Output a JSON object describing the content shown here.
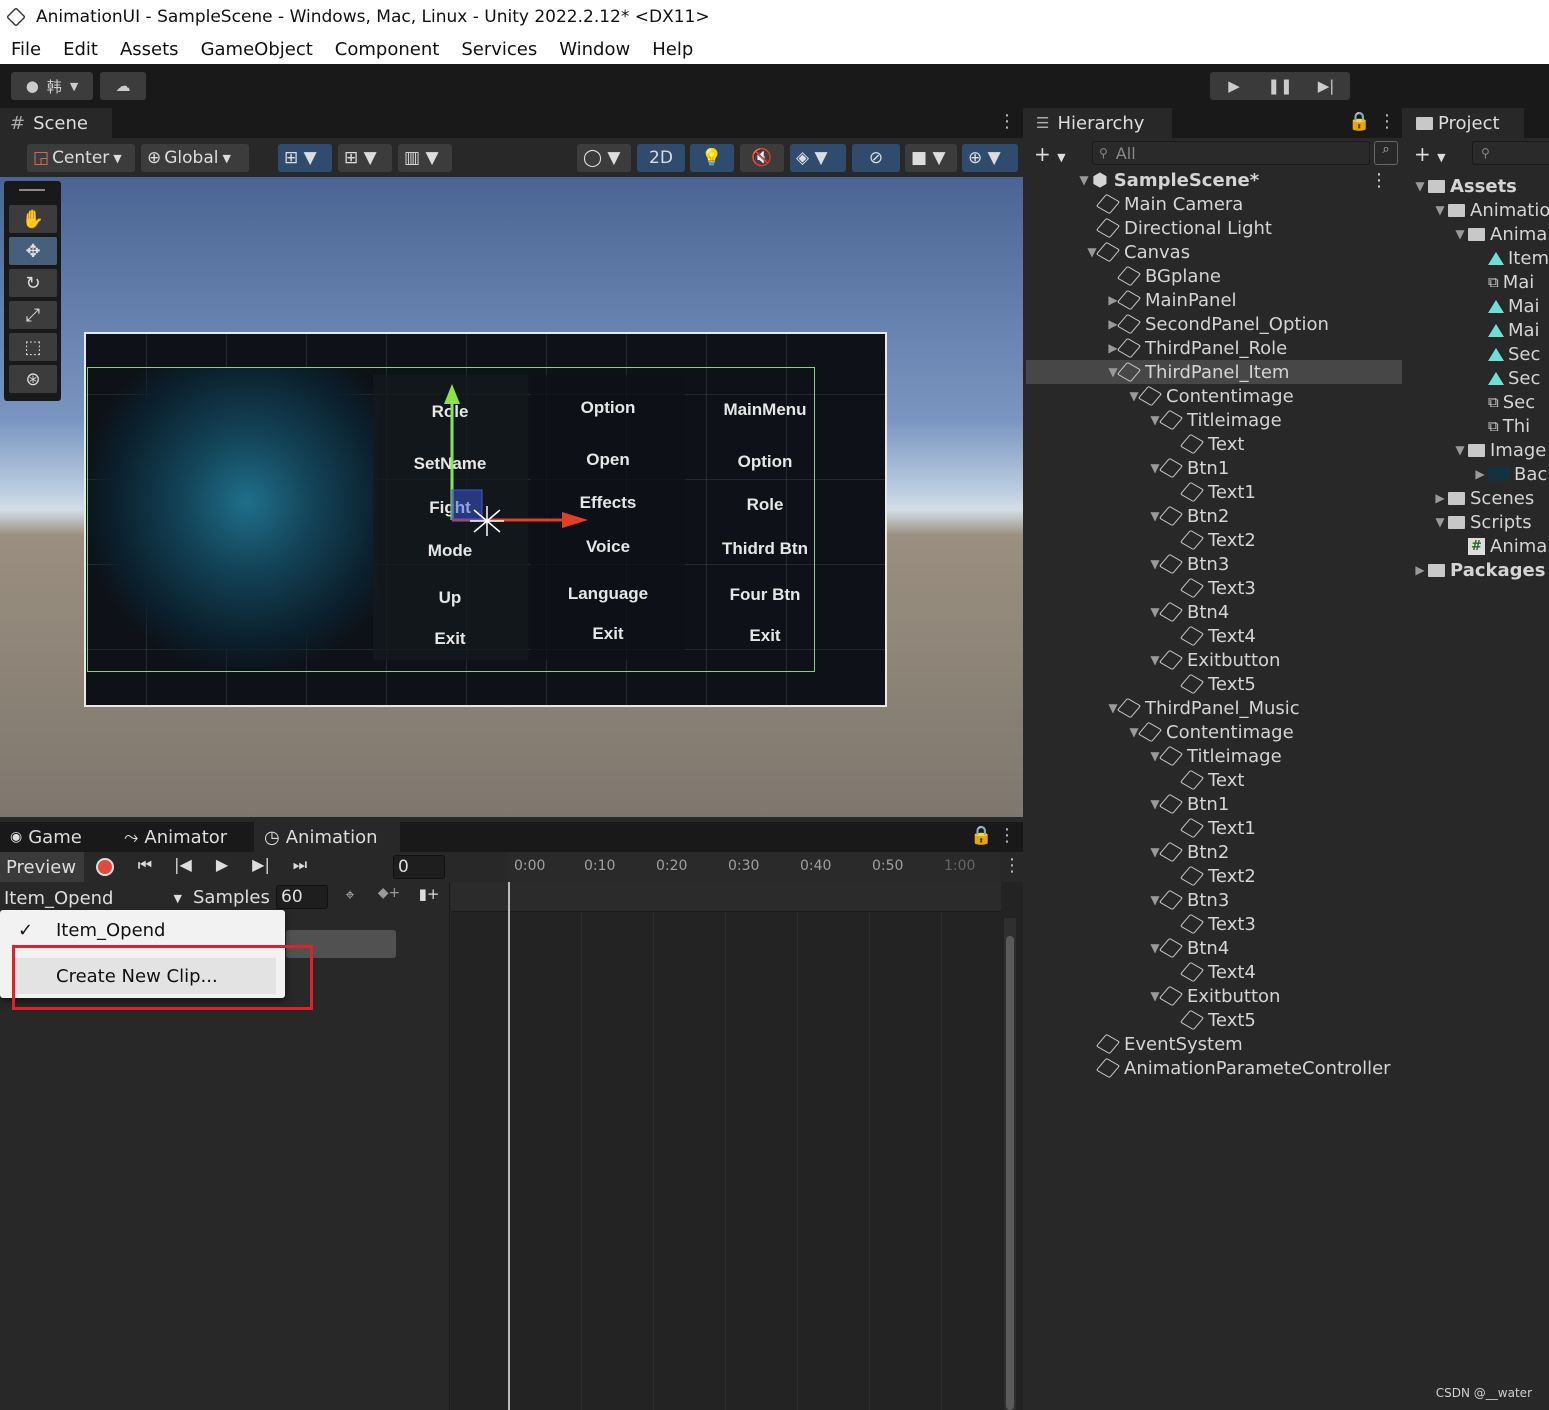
{
  "window": {
    "title": "AnimationUI - SampleScene - Windows, Mac, Linux - Unity 2022.2.12* <DX11>"
  },
  "menu": [
    "File",
    "Edit",
    "Assets",
    "GameObject",
    "Component",
    "Services",
    "Window",
    "Help"
  ],
  "toolbar": {
    "account_label": "韩"
  },
  "scene": {
    "tab_label": "Scene",
    "pivot_label": "Center",
    "space_label": "Global",
    "mode_2d_label": "2D",
    "canvas_texts": {
      "col1": [
        "Role",
        "SetName",
        "Fight",
        "Mode",
        "Up",
        "Exit"
      ],
      "col2": [
        "Option",
        "Open",
        "Effects",
        "Voice",
        "Language",
        "Exit"
      ],
      "col3": [
        "MainMenu",
        "Option",
        "Role",
        "Thidrd Btn",
        "Four Btn",
        "Exit"
      ]
    }
  },
  "hierarchy": {
    "tab_label": "Hierarchy",
    "search_placeholder": "All",
    "scene_name": "SampleScene*",
    "items": [
      {
        "label": "Main Camera",
        "depth": 1,
        "arrow": ""
      },
      {
        "label": "Directional Light",
        "depth": 1,
        "arrow": ""
      },
      {
        "label": "Canvas",
        "depth": 1,
        "arrow": "down"
      },
      {
        "label": "BGplane",
        "depth": 2,
        "arrow": ""
      },
      {
        "label": "MainPanel",
        "depth": 2,
        "arrow": "right"
      },
      {
        "label": "SecondPanel_Option",
        "depth": 2,
        "arrow": "right"
      },
      {
        "label": "ThirdPanel_Role",
        "depth": 2,
        "arrow": "right"
      },
      {
        "label": "ThirdPanel_Item",
        "depth": 2,
        "arrow": "down",
        "selected": true
      },
      {
        "label": "Contentimage",
        "depth": 3,
        "arrow": "down"
      },
      {
        "label": "Titleimage",
        "depth": 4,
        "arrow": "down"
      },
      {
        "label": "Text",
        "depth": 5,
        "arrow": ""
      },
      {
        "label": "Btn1",
        "depth": 4,
        "arrow": "down"
      },
      {
        "label": "Text1",
        "depth": 5,
        "arrow": ""
      },
      {
        "label": "Btn2",
        "depth": 4,
        "arrow": "down"
      },
      {
        "label": "Text2",
        "depth": 5,
        "arrow": ""
      },
      {
        "label": "Btn3",
        "depth": 4,
        "arrow": "down"
      },
      {
        "label": "Text3",
        "depth": 5,
        "arrow": ""
      },
      {
        "label": "Btn4",
        "depth": 4,
        "arrow": "down"
      },
      {
        "label": "Text4",
        "depth": 5,
        "arrow": ""
      },
      {
        "label": "Exitbutton",
        "depth": 4,
        "arrow": "down"
      },
      {
        "label": "Text5",
        "depth": 5,
        "arrow": ""
      },
      {
        "label": "ThirdPanel_Music",
        "depth": 2,
        "arrow": "down"
      },
      {
        "label": "Contentimage",
        "depth": 3,
        "arrow": "down"
      },
      {
        "label": "Titleimage",
        "depth": 4,
        "arrow": "down"
      },
      {
        "label": "Text",
        "depth": 5,
        "arrow": ""
      },
      {
        "label": "Btn1",
        "depth": 4,
        "arrow": "down"
      },
      {
        "label": "Text1",
        "depth": 5,
        "arrow": ""
      },
      {
        "label": "Btn2",
        "depth": 4,
        "arrow": "down"
      },
      {
        "label": "Text2",
        "depth": 5,
        "arrow": ""
      },
      {
        "label": "Btn3",
        "depth": 4,
        "arrow": "down"
      },
      {
        "label": "Text3",
        "depth": 5,
        "arrow": ""
      },
      {
        "label": "Btn4",
        "depth": 4,
        "arrow": "down"
      },
      {
        "label": "Text4",
        "depth": 5,
        "arrow": ""
      },
      {
        "label": "Exitbutton",
        "depth": 4,
        "arrow": "down"
      },
      {
        "label": "Text5",
        "depth": 5,
        "arrow": ""
      },
      {
        "label": "EventSystem",
        "depth": 1,
        "arrow": ""
      },
      {
        "label": "AnimationParameteController",
        "depth": 1,
        "arrow": ""
      }
    ]
  },
  "project": {
    "tab_label": "Project",
    "items": [
      {
        "label": "Assets",
        "depth": 0,
        "icon": "folder-open",
        "bold": true
      },
      {
        "label": "Animatio",
        "depth": 1,
        "icon": "folder-open"
      },
      {
        "label": "Anima",
        "depth": 2,
        "icon": "folder-open"
      },
      {
        "label": "Item",
        "depth": 3,
        "icon": "clip"
      },
      {
        "label": "Mai",
        "depth": 3,
        "icon": "controller"
      },
      {
        "label": "Mai",
        "depth": 3,
        "icon": "clip"
      },
      {
        "label": "Mai",
        "depth": 3,
        "icon": "clip"
      },
      {
        "label": "Sec",
        "depth": 3,
        "icon": "clip"
      },
      {
        "label": "Sec",
        "depth": 3,
        "icon": "clip"
      },
      {
        "label": "Sec",
        "depth": 3,
        "icon": "controller"
      },
      {
        "label": "Thi",
        "depth": 3,
        "icon": "controller"
      },
      {
        "label": "Image",
        "depth": 2,
        "icon": "folder-open"
      },
      {
        "label": "Bac",
        "depth": 3,
        "icon": "texture"
      },
      {
        "label": "Scenes",
        "depth": 1,
        "icon": "folder"
      },
      {
        "label": "Scripts",
        "depth": 1,
        "icon": "folder-open"
      },
      {
        "label": "Anima",
        "depth": 2,
        "icon": "script"
      },
      {
        "label": "Packages",
        "depth": 0,
        "icon": "folder",
        "bold": true
      }
    ]
  },
  "bottom_tabs": {
    "game": "Game",
    "animator": "Animator",
    "animation": "Animation"
  },
  "animation": {
    "preview_label": "Preview",
    "frame_value": "0",
    "clip_name": "Item_Opend",
    "samples_label": "Samples",
    "samples_value": "60",
    "ticks": [
      "0:00",
      "0:10",
      "0:20",
      "0:30",
      "0:40",
      "0:50",
      "1:00"
    ],
    "dropdown": {
      "checked_item": "Item_Opend",
      "create_item": "Create New Clip..."
    }
  },
  "watermark": "CSDN @__water",
  "colors": {
    "highlight": "#e0202a",
    "record": "#e04a3a",
    "selection": "#474747"
  }
}
